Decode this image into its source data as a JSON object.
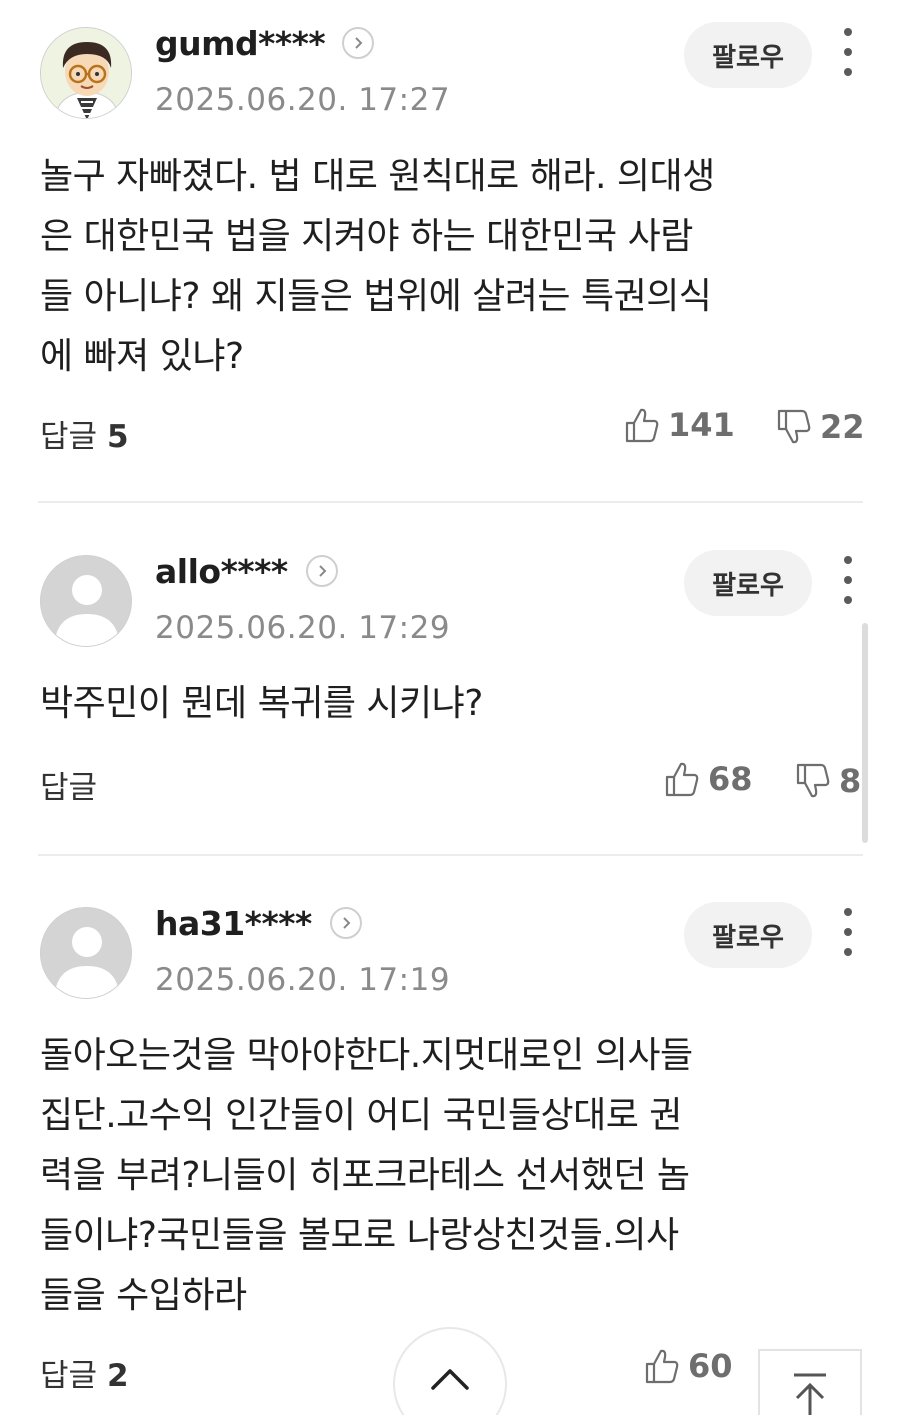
{
  "comments": [
    {
      "username": "gumd****",
      "timestamp": "2025.06.20. 17:27",
      "follow_label": "팔로우",
      "lines": [
        "놀구 자빠졌다. 법 대로 원칙대로 해라. 의대생",
        "은 대한민국 법을 지켜야 하는 대한민국 사람",
        "들 아니냐? 왜 지들은 법위에 살려는 특권의식",
        "에 빠져 있냐?"
      ],
      "reply_label": "답글",
      "reply_count": "5",
      "likes": "141",
      "dislikes": "22",
      "avatar": "cartoon-glasses-avatar"
    },
    {
      "username": "allo****",
      "timestamp": "2025.06.20. 17:29",
      "follow_label": "팔로우",
      "lines": [
        "박주민이 뭔데 복귀를 시키냐?"
      ],
      "reply_label": "답글",
      "reply_count": "",
      "likes": "68",
      "dislikes": "8",
      "avatar": "default-avatar"
    },
    {
      "username": "ha31****",
      "timestamp": "2025.06.20. 17:19",
      "follow_label": "팔로우",
      "lines": [
        "돌아오는것을 막아야한다.지멋대로인 의사들",
        "집단.고수익 인간들이 어디 국민들상대로 권",
        "력을 부려?니들이 히포크라테스 선서했던 놈",
        "들이냐?국민들을 볼모로 나랑상친것들.의사",
        "들을 수입하라"
      ],
      "reply_label": "답글",
      "reply_count": "2",
      "likes": "60",
      "dislikes": "",
      "avatar": "default-avatar"
    }
  ],
  "icons": {
    "profile": "chevron-right-icon",
    "more": "more-vertical-icon",
    "like": "thumbs-up-icon",
    "dislike": "thumbs-down-icon",
    "collapse": "chevron-up-icon",
    "top": "arrow-to-top-icon"
  },
  "colors": {
    "text": "#1f1f1f",
    "muted": "#8a8a8a",
    "button_bg": "#f2f2f2",
    "divider": "#ececec"
  }
}
